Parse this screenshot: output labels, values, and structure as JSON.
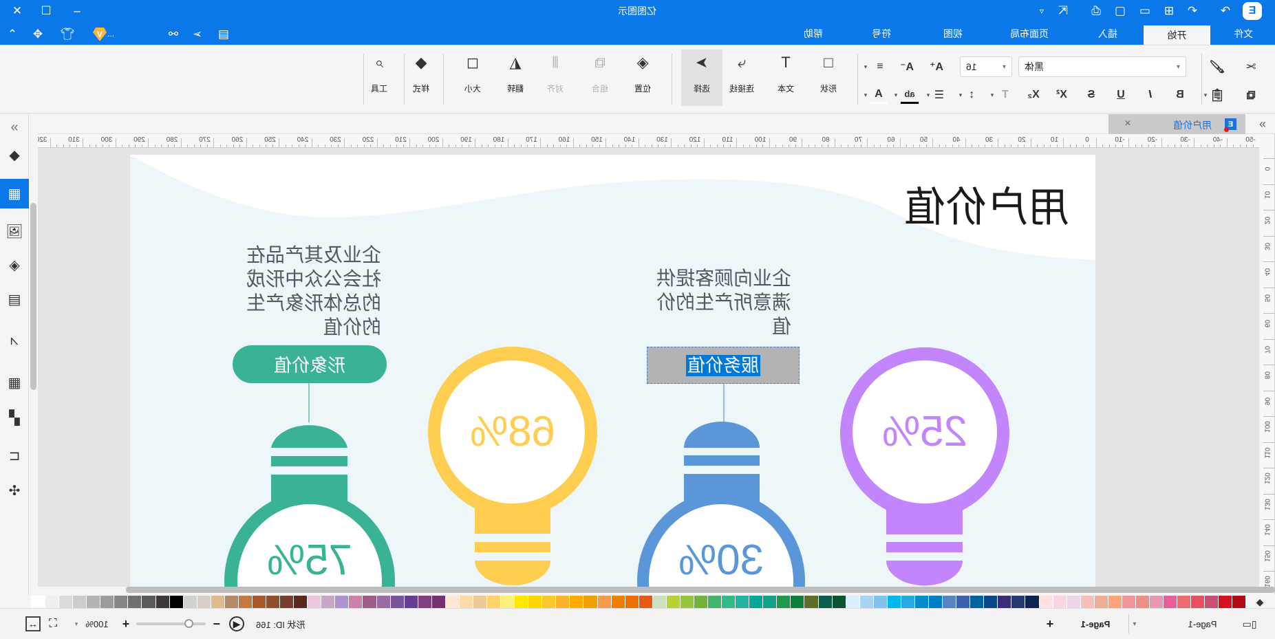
{
  "app": {
    "title": "亿图图示"
  },
  "window": {
    "close_icon": "close-icon",
    "maximize_icon": "maximize-icon",
    "minimize_icon": "minimize-icon"
  },
  "quick_access": {
    "more": "...",
    "icons": [
      "collapse-ribbon-icon",
      "apps-icon",
      "theme-shirt-icon",
      "vip-icon",
      "share-icon",
      "send-icon",
      "comment-icon",
      "dropdown-icon",
      "export-icon",
      "print-icon",
      "save-icon",
      "open-icon",
      "new-icon",
      "undo-icon",
      "redo-icon",
      "logo-icon"
    ]
  },
  "menu_tabs": [
    {
      "label": "文件"
    },
    {
      "label": "开始",
      "active": true
    },
    {
      "label": "插入"
    },
    {
      "label": "页面布局"
    },
    {
      "label": "视图"
    },
    {
      "label": "符号"
    },
    {
      "label": "帮助"
    }
  ],
  "ribbon": {
    "clipboard": {
      "cut": "cut-icon",
      "copy": "copy-icon",
      "format_painter": "format-painter-icon",
      "paste": "paste-icon"
    },
    "font": {
      "name": "黑体",
      "size": "16"
    },
    "buttons": [
      {
        "label": "形状",
        "icon": "shape-icon"
      },
      {
        "label": "文本",
        "icon": "text-icon"
      },
      {
        "label": "连接线",
        "icon": "connector-icon"
      },
      {
        "label": "选择",
        "icon": "select-icon",
        "active": true
      },
      {
        "label": "位置",
        "icon": "position-icon"
      },
      {
        "label": "组合",
        "icon": "group-icon",
        "disabled": true
      },
      {
        "label": "对齐",
        "icon": "align-icon",
        "disabled": true
      },
      {
        "label": "翻转",
        "icon": "flip-icon"
      },
      {
        "label": "大小",
        "icon": "size-icon"
      },
      {
        "label": "样式",
        "icon": "style-icon"
      },
      {
        "label": "工具",
        "icon": "tools-icon"
      }
    ]
  },
  "document_tab": {
    "label": "用户价值",
    "close": "×"
  },
  "rulers": {
    "top": [
      320,
      310,
      300,
      290,
      280,
      270,
      260,
      250,
      240,
      230,
      220,
      210,
      200,
      190,
      180,
      170,
      160,
      150,
      140,
      130,
      120,
      110,
      100,
      90,
      80,
      70,
      60,
      50,
      40,
      30,
      20,
      10,
      0,
      -10,
      -20,
      -30,
      -40,
      -50
    ],
    "side": [
      0,
      10,
      20,
      30,
      40,
      50,
      60,
      70,
      80,
      90,
      100,
      110,
      120,
      130,
      140,
      150,
      160,
      170
    ]
  },
  "sidebar": {
    "items": [
      "expand-icon",
      "fill-icon",
      "symbol-library-icon",
      "image-icon",
      "layers-icon",
      "page-icon",
      "chart-icon",
      "table-icon",
      "blocks-icon",
      "tree-icon",
      "mindmap-icon"
    ],
    "active": "symbol-library-icon"
  },
  "canvas": {
    "title": "用户价值",
    "items": [
      {
        "label": "形象价值",
        "description": [
          "企业及其产品在",
          "社会公众中形成",
          "的总体形象产生",
          "的价值"
        ],
        "percent": "75%",
        "color": "#3ab394"
      },
      {
        "percent": "68%",
        "color": "#ffcd50"
      },
      {
        "label": "服务价值",
        "description": [
          "企业向顾客提供",
          "满意所产生的价",
          "值"
        ],
        "percent": "30%",
        "color": "#5a96d8",
        "selected": true
      },
      {
        "percent": "25%",
        "color": "#c285fb"
      }
    ]
  },
  "palette": [
    "#ffffff",
    "#efefef",
    "#dcdcdc",
    "#cccccc",
    "#b4b4b4",
    "#9c9c9c",
    "#878787",
    "#6f6f6f",
    "#595959",
    "#3d3939",
    "#000000",
    "#ccd5cc",
    "#d8d0c8",
    "#e0bb8a",
    "#b5896a",
    "#c47a3e",
    "#a8562a",
    "#934f2c",
    "#7a3e31",
    "#5a281c",
    "#ecc6da",
    "#c9a6c8",
    "#ab93cf",
    "#cf7fad",
    "#a05d8a",
    "#9a6aa3",
    "#77559b",
    "#653f92",
    "#823f80",
    "#773170",
    "#fde8d4",
    "#fedaa9",
    "#ebcb9a",
    "#fed36e",
    "#fcf17e",
    "#ffe800",
    "#ffd400",
    "#fac92d",
    "#fdb42b",
    "#ffab00",
    "#f0a000",
    "#f39a4d",
    "#f07f00",
    "#ee6e00",
    "#e85a12",
    "#cde0c0",
    "#b5d334",
    "#96c43c",
    "#72b43a",
    "#43b56a",
    "#34b98a",
    "#23b3a0",
    "#00a79b",
    "#14a085",
    "#1e9a4a",
    "#0f7f3a",
    "#5d6e2b",
    "#0b5f4d",
    "#0a5432",
    "#dbeefa",
    "#a8d4ef",
    "#80c2ea",
    "#00b8ee",
    "#28a8e0",
    "#008ecb",
    "#007dc5",
    "#5485c1",
    "#3d62ab",
    "#0062a0",
    "#07478a",
    "#3e2b77",
    "#233a6e",
    "#10224f",
    "#ffe0e5",
    "#fdd4e4",
    "#ead6e8",
    "#f6bfb9",
    "#f0ad96",
    "#ffa478",
    "#f2929a",
    "#ee8f84",
    "#e498b2",
    "#e75f99",
    "#ec6c70",
    "#e8505f",
    "#c94f72",
    "#d7101f",
    "#b30a17"
  ],
  "status": {
    "zoom": "100%",
    "shape_id": "形状 ID: 166",
    "page_tab": "Page-1",
    "page_current": "Page-1",
    "add_page": "+",
    "zoom_in": "+",
    "zoom_out": "−",
    "zoom_level": 0.75
  }
}
